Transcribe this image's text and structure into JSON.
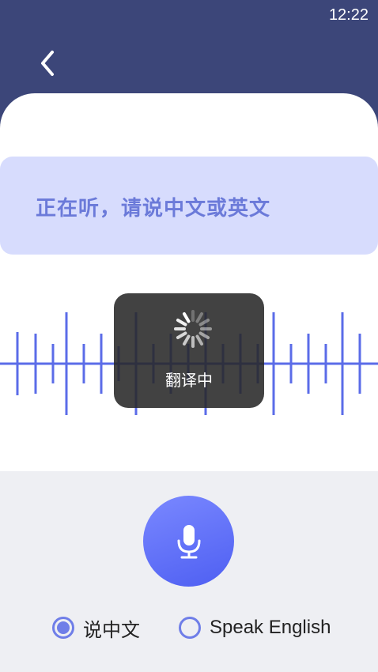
{
  "status_bar": {
    "time": "12:22"
  },
  "prompt": {
    "text": "正在听，请说中文或英文"
  },
  "toast": {
    "text": "翻译中"
  },
  "language_options": [
    {
      "label": "说中文",
      "selected": true
    },
    {
      "label": "Speak English",
      "selected": false
    }
  ],
  "colors": {
    "header": "#3c4679",
    "accent": "#6f7ee8",
    "prompt_bg": "#d7dcfd",
    "bottom_bg": "#eeeff3"
  },
  "icons": [
    "back-arrow-icon",
    "spinner-icon",
    "microphone-icon",
    "radio-selected-icon",
    "radio-unselected-icon"
  ]
}
